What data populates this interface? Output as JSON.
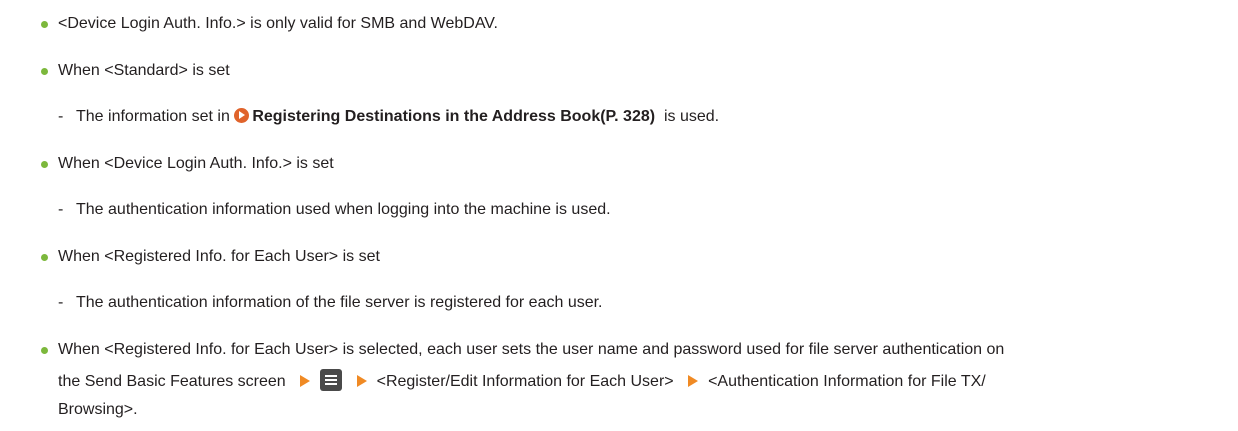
{
  "items": [
    {
      "text": "<Device Login Auth. Info.> is only valid for SMB and WebDAV."
    },
    {
      "text": "When <Standard> is set",
      "sub": {
        "prefix": "The information set in",
        "link": "Registering Destinations in the Address Book(P. 328)",
        "suffix": "is used."
      }
    },
    {
      "text": "When <Device Login Auth. Info.> is set",
      "sub": {
        "text": "The authentication information used when logging into the machine is used."
      }
    },
    {
      "text": "When <Registered Info. for Each User> is set",
      "sub": {
        "text": "The authentication information of the file server is registered for each user."
      }
    },
    {
      "line1": "When <Registered Info. for Each User> is selected, each user sets the user name and password used for file server authentication on",
      "line2_start": "the Send Basic Features screen",
      "menu_icon": "menu-icon",
      "step1": "<Register/Edit Information for Each User>",
      "step2": "<Authentication Information for File TX/",
      "line3": "Browsing>."
    }
  ],
  "colors": {
    "bullet": "#7cb83c",
    "arrow": "#f08a24",
    "link_icon": "#e0632b"
  },
  "sub_dash": "-"
}
